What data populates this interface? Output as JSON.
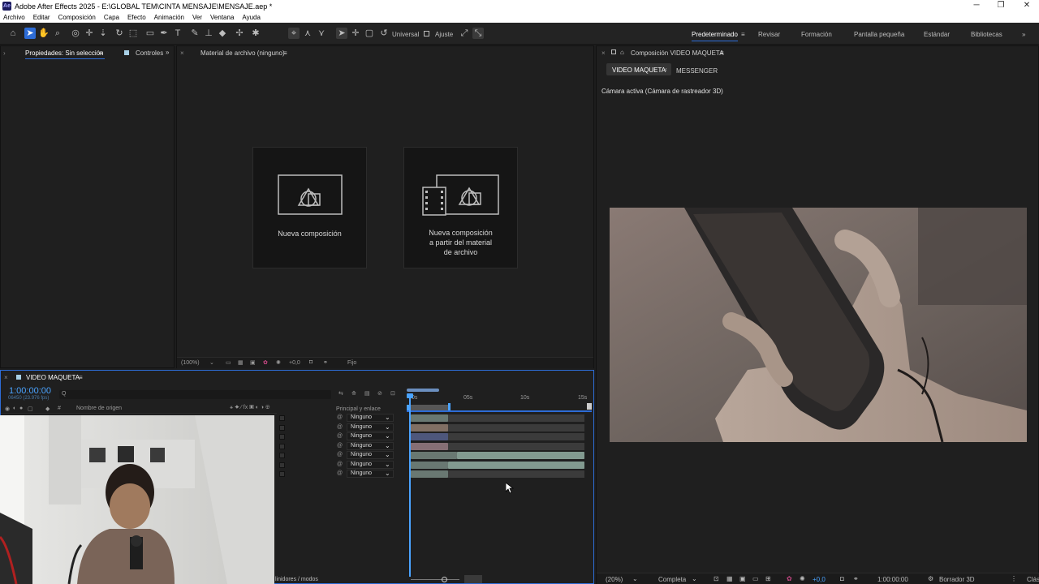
{
  "window": {
    "title": "Adobe After Effects 2025 - E:\\GLOBAL TEM\\CINTA MENSAJE\\MENSAJE.aep *",
    "app_icon": "Ae",
    "controls": [
      "─",
      "❐",
      "✕"
    ]
  },
  "menu": [
    "Archivo",
    "Editar",
    "Composición",
    "Capa",
    "Efecto",
    "Animación",
    "Ver",
    "Ventana",
    "Ayuda"
  ],
  "toolbar": {
    "universal_label": "Universal",
    "ajuste_label": "Ajuste",
    "workspaces": [
      "Predeterminado",
      "Revisar",
      "Formación",
      "Pantalla pequeña",
      "Estándar",
      "Bibliotecas"
    ],
    "active_workspace": "Predeterminado",
    "more": "»"
  },
  "left_panel": {
    "tab_properties": "Propiedades: Sin selección",
    "tab_controls": "Controles",
    "more": "»"
  },
  "footage_panel": {
    "title": "Material de archivo (ninguno)",
    "tile_new_comp": "Nueva composición",
    "tile_from_footage_line1": "Nueva composición",
    "tile_from_footage_line2": "a partir del material",
    "tile_from_footage_line3": "de archivo",
    "zoom": "(100%)",
    "exposure": "+0,0",
    "mode": "Fijo"
  },
  "comp_panel": {
    "title": "Composición VIDEO MAQUETA",
    "tabs": [
      "VIDEO MAQUETA",
      "MESSENGER"
    ],
    "camera_label": "Cámara activa (Cámara de rastreador 3D)",
    "zoom": "(20%)",
    "resolution": "Completa",
    "exposure": "+0,0",
    "timecode": "1:00:00:00",
    "renderer": "Borrador 3D",
    "cut_label": "Clás"
  },
  "timeline": {
    "tab": "VIDEO MAQUETA",
    "timecode": "1:00:00:00",
    "frames_sub": "06450 (23.976 fps)",
    "search_placeholder": "Q",
    "col_source": "Nombre de origen",
    "col_parent": "Principal y enlace",
    "ruler": [
      "0s",
      "05s",
      "10s",
      "15s"
    ],
    "layers": [
      {
        "parent": "Ninguno",
        "color": "#8faba0"
      },
      {
        "parent": "Ninguno",
        "color": "#b99a86"
      },
      {
        "parent": "Ninguno",
        "color": "#5f6fb2"
      },
      {
        "parent": "Ninguno",
        "color": "#c49aa6"
      },
      {
        "parent": "Ninguno",
        "color": "#8faba0"
      },
      {
        "parent": "Ninguno",
        "color": "#8faba0"
      },
      {
        "parent": "Ninguno",
        "color": "#8faba0"
      }
    ],
    "footer_toggle": "linidores / modos"
  },
  "colors": {
    "accent": "#2d6cd6",
    "timecode": "#4aa3ff"
  }
}
